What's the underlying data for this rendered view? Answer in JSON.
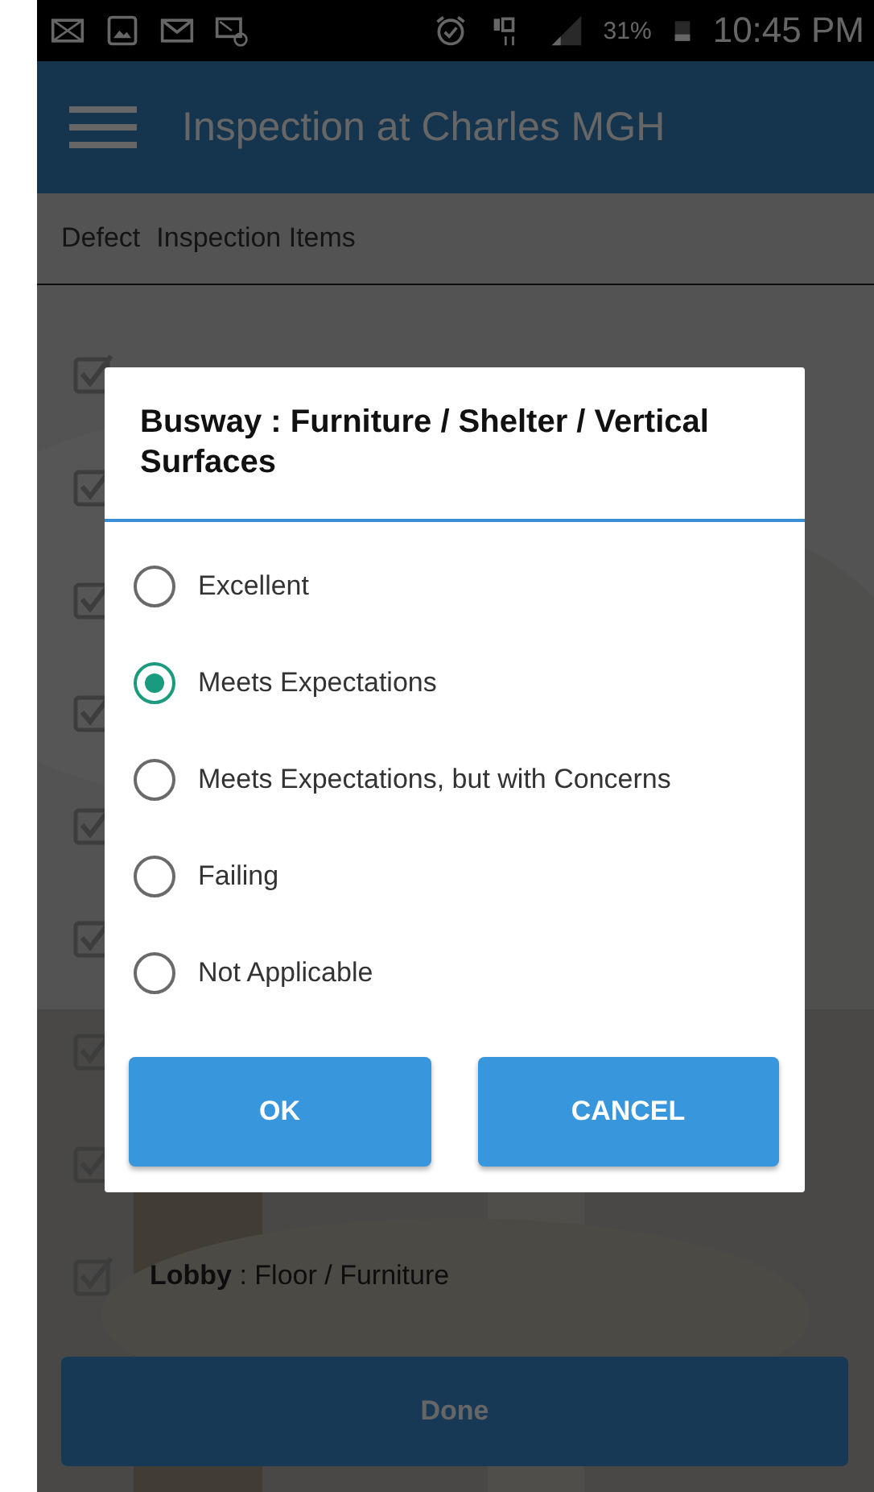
{
  "status_bar": {
    "battery_percent": "31%",
    "time": "10:45 PM"
  },
  "app_bar": {
    "title": "Inspection at Charles MGH"
  },
  "header": {
    "columns": [
      "Defect",
      "Inspection Items"
    ]
  },
  "items": [
    {
      "checked": true
    },
    {
      "checked": true
    },
    {
      "checked": true
    },
    {
      "checked": true
    },
    {
      "checked": true
    },
    {
      "checked": true
    },
    {
      "checked": true
    },
    {
      "checked": true
    },
    {
      "checked": true,
      "label": "**Lobby** : Floor / Furniture"
    }
  ],
  "dialog": {
    "title": "Busway : Furniture / Shelter / Vertical Surfaces",
    "options": [
      {
        "label": "Excellent",
        "selected": false
      },
      {
        "label": "Meets Expectations",
        "selected": true
      },
      {
        "label": "Meets Expectations, but with Concerns",
        "selected": false
      },
      {
        "label": "Failing",
        "selected": false
      },
      {
        "label": "Not Applicable",
        "selected": false
      }
    ],
    "buttons": [
      "OK",
      "CANCEL"
    ]
  },
  "footer": {
    "button": "Done"
  }
}
